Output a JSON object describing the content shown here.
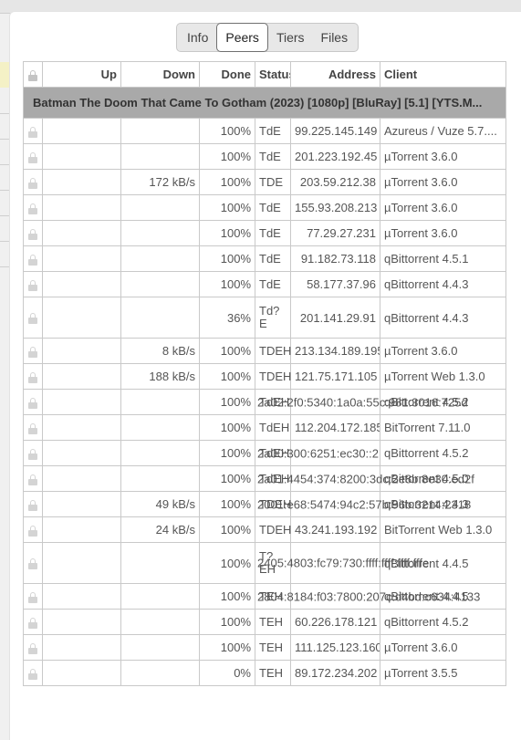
{
  "tabs": [
    {
      "label": "Info",
      "active": false
    },
    {
      "label": "Peers",
      "active": true
    },
    {
      "label": "Tiers",
      "active": false
    },
    {
      "label": "Files",
      "active": false
    }
  ],
  "columns": {
    "up": "Up",
    "down": "Down",
    "done": "Done",
    "status": "Status",
    "address": "Address",
    "client": "Client"
  },
  "torrent_name": "Batman The Doom That Came To Gotham (2023) [1080p] [BluRay] [5.1] [YTS.M...",
  "peers": [
    {
      "up": "",
      "down": "",
      "done": "100%",
      "status": "TdE",
      "address": "99.225.145.149",
      "client": "Azureus / Vuze 5.7...."
    },
    {
      "up": "",
      "down": "",
      "done": "100%",
      "status": "TdE",
      "address": "201.223.192.45",
      "client": "µTorrent 3.6.0"
    },
    {
      "up": "",
      "down": "172 kB/s",
      "done": "100%",
      "status": "TDE",
      "address": "203.59.212.38",
      "client": "µTorrent 3.6.0"
    },
    {
      "up": "",
      "down": "",
      "done": "100%",
      "status": "TdE",
      "address": "155.93.208.213",
      "client": "µTorrent 3.6.0"
    },
    {
      "up": "",
      "down": "",
      "done": "100%",
      "status": "TdE",
      "address": "77.29.27.231",
      "client": "µTorrent 3.6.0"
    },
    {
      "up": "",
      "down": "",
      "done": "100%",
      "status": "TdE",
      "address": "91.182.73.118",
      "client": "qBittorrent 4.5.1"
    },
    {
      "up": "",
      "down": "",
      "done": "100%",
      "status": "TdE",
      "address": "58.177.37.96",
      "client": "qBittorrent 4.4.3"
    },
    {
      "up": "",
      "down": "",
      "done": "36%",
      "status": "Td?\nE",
      "address": "201.141.29.91",
      "client": "qBittorrent 4.4.3",
      "tall": true
    },
    {
      "up": "",
      "down": "8 kB/s",
      "done": "100%",
      "status": "TDEH",
      "address": "213.134.189.195",
      "client": "µTorrent 3.6.0"
    },
    {
      "up": "",
      "down": "188 kB/s",
      "done": "100%",
      "status": "TDEH",
      "address": "121.75.171.105",
      "client": "µTorrent Web 1.3.0"
    },
    {
      "up": "",
      "down": "",
      "done": "100%",
      "status": "TdEH",
      "address": "2a02:2f0:5340:1a0a:55c:981:3016:725d",
      "client": "qBittorrent 4.5.2",
      "overlap": true
    },
    {
      "up": "",
      "down": "",
      "done": "100%",
      "status": "TdEH",
      "address": "112.204.172.185",
      "client": "BitTorrent 7.11.0"
    },
    {
      "up": "",
      "down": "",
      "done": "100%",
      "status": "TdEH",
      "address": "2a00:300:6251:ec30::2",
      "client": "qBittorrent 4.5.2",
      "overlap": true
    },
    {
      "up": "",
      "down": "",
      "done": "100%",
      "status": "TdEH",
      "address": "2a01:4454:374:8200:3dc:2e8b:8e30:ed2f",
      "client": "qBittorrent 4.5.0",
      "overlap": true
    },
    {
      "up": "",
      "down": "49 kB/s",
      "done": "100%",
      "status": "TDEH",
      "address": "2001:e68:5474:94c2:57b:96b:3214:2318",
      "client": "qBittorrent 4.4.3",
      "overlap": true
    },
    {
      "up": "",
      "down": "24 kB/s",
      "done": "100%",
      "status": "TDEH",
      "address": "43.241.193.192",
      "client": "BitTorrent Web 1.3.0"
    },
    {
      "up": "",
      "down": "",
      "done": "100%",
      "status": "T?\nEH",
      "address": "2405:4803:fc79:730:ffff:ffff:ffff:fffe",
      "client": "qBittorrent 4.4.5",
      "tall": true,
      "overlap": true
    },
    {
      "up": "",
      "down": "",
      "done": "100%",
      "status": "TEH",
      "address": "2804:8184:f03:7800:207c:d4bd:c634:4133",
      "client": "qBittorrent 4.4.5",
      "overlap": true
    },
    {
      "up": "",
      "down": "",
      "done": "100%",
      "status": "TEH",
      "address": "60.226.178.121",
      "client": "qBittorrent 4.5.2"
    },
    {
      "up": "",
      "down": "",
      "done": "100%",
      "status": "TEH",
      "address": "111.125.123.160",
      "client": "µTorrent 3.6.0"
    },
    {
      "up": "",
      "down": "",
      "done": "0%",
      "status": "TEH",
      "address": "89.172.234.202",
      "client": "µTorrent 3.5.5"
    }
  ]
}
